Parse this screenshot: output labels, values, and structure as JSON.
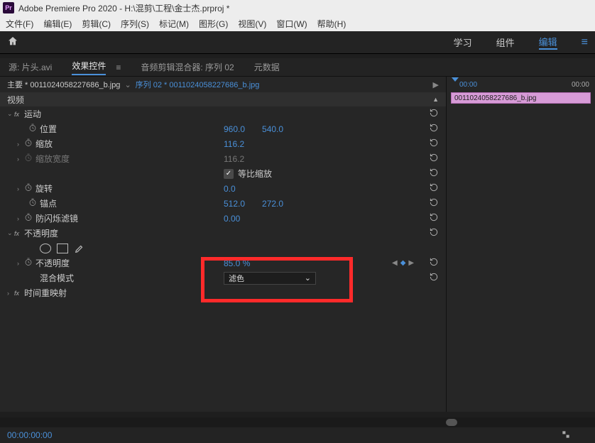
{
  "title": "Adobe Premiere Pro 2020 - H:\\混剪\\工程\\金士杰.prproj *",
  "menus": [
    "文件(F)",
    "编辑(E)",
    "剪辑(C)",
    "序列(S)",
    "标记(M)",
    "图形(G)",
    "视图(V)",
    "窗口(W)",
    "帮助(H)"
  ],
  "workspaces": {
    "learn": "学习",
    "assembly": "组件",
    "editing": "编辑"
  },
  "panel_tabs": {
    "source": "源: 片头.avi",
    "effects": "效果控件",
    "mixer": "音频剪辑混合器: 序列 02",
    "metadata": "元数据"
  },
  "breadcrumb": {
    "main": "主要 * 0011024058227686_b.jpg",
    "seq": "序列 02 * 0011024058227686_b.jpg"
  },
  "section": {
    "video": "视频"
  },
  "motion": {
    "title": "运动",
    "position": "位置",
    "position_x": "960.0",
    "position_y": "540.0",
    "scale": "缩放",
    "scale_v": "116.2",
    "scale_w": "缩放宽度",
    "scale_w_v": "116.2",
    "uniform": "等比缩放",
    "rotation": "旋转",
    "rotation_v": "0.0",
    "anchor": "锚点",
    "anchor_x": "512.0",
    "anchor_y": "272.0",
    "flicker": "防闪烁滤镜",
    "flicker_v": "0.00"
  },
  "opacity": {
    "title": "不透明度",
    "opacity": "不透明度",
    "opacity_v": "85.0 %",
    "blend": "混合模式",
    "blend_v": "滤色"
  },
  "time_remap": "时间重映射",
  "timeline": {
    "start": "00:00",
    "end": "00:00",
    "clip": "0011024058227686_b.jpg"
  },
  "timecode": "00:00:00:00"
}
